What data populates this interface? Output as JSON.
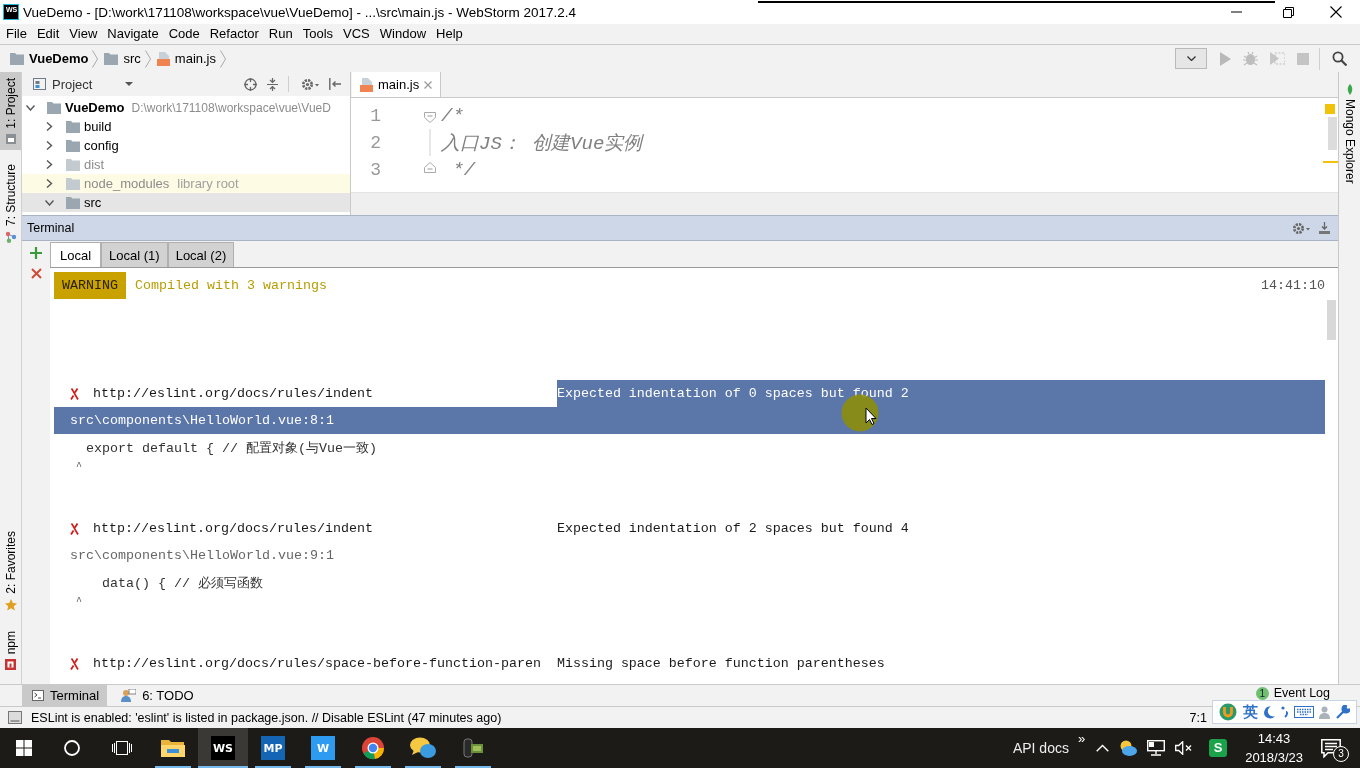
{
  "window": {
    "app_badge": "WS",
    "title": "VueDemo - [D:\\work\\171108\\workspace\\vue\\VueDemo] - ...\\src\\main.js - WebStorm 2017.2.4"
  },
  "menu_bar": [
    "File",
    "Edit",
    "View",
    "Navigate",
    "Code",
    "Refactor",
    "Run",
    "Tools",
    "VCS",
    "Window",
    "Help"
  ],
  "navigation_bar": {
    "breadcrumbs": [
      {
        "kind": "project",
        "label": "VueDemo"
      },
      {
        "kind": "folder",
        "label": "src"
      },
      {
        "kind": "js-file",
        "label": "main.js"
      }
    ]
  },
  "left_tool_strip": {
    "top": [
      {
        "kind": "project",
        "label": "1: Project",
        "selected": true
      },
      {
        "kind": "structure",
        "label": "7: Structure",
        "selected": false
      }
    ],
    "bottom": [
      {
        "kind": "favorites",
        "label": "2: Favorites",
        "selected": false
      },
      {
        "kind": "npm",
        "label": "npm",
        "selected": false
      }
    ]
  },
  "right_tool_strip": [
    {
      "kind": "mongo",
      "label": "Mongo Explorer",
      "selected": false
    }
  ],
  "project_panel": {
    "title": "Project",
    "tree": [
      {
        "name": "VueDemo",
        "path": "D:\\work\\171108\\workspace\\vue\\VueD",
        "expanded": true,
        "selected": false,
        "dimmed": false,
        "highlighted": false,
        "children": [
          {
            "name": "build",
            "expanded": false,
            "selected": false,
            "dimmed": false,
            "highlighted": false
          },
          {
            "name": "config",
            "expanded": false,
            "selected": false,
            "dimmed": false,
            "highlighted": false
          },
          {
            "name": "dist",
            "expanded": false,
            "selected": false,
            "dimmed": true,
            "highlighted": false
          },
          {
            "name": "node_modules",
            "note": "library root",
            "expanded": false,
            "selected": false,
            "dimmed": true,
            "highlighted": true
          },
          {
            "name": "src",
            "expanded": true,
            "selected": true,
            "dimmed": false,
            "highlighted": false
          }
        ]
      }
    ]
  },
  "editor": {
    "tabs": [
      {
        "label": "main.js",
        "selected": true
      }
    ],
    "lines": [
      {
        "kind": "fold-start",
        "number": "1",
        "text": "/*"
      },
      {
        "kind": "fold-inside",
        "number": "2",
        "text": "入口JS： 创建Vue实例"
      },
      {
        "kind": "fold-end",
        "number": "3",
        "text": " */"
      }
    ]
  },
  "terminal": {
    "title": "Terminal",
    "tabs": [
      {
        "label": "Local",
        "selected": true
      },
      {
        "label": "Local (1)",
        "selected": false
      },
      {
        "label": "Local (2)",
        "selected": false
      }
    ],
    "warning": {
      "badge": "WARNING",
      "text": "Compiled with 3 warnings",
      "time": "14:41:10"
    },
    "problems": [
      {
        "url": "http://eslint.org/docs/rules/indent",
        "message": "Expected indentation of 0 spaces but found 2",
        "location": "src\\components\\HelloWorld.vue:8:1",
        "code": "  export default { // 配置对象(与Vue一致)",
        "caret": " ^",
        "highlighted": true
      },
      {
        "url": "http://eslint.org/docs/rules/indent",
        "message": "Expected indentation of 2 spaces but found 4",
        "location": "src\\components\\HelloWorld.vue:9:1",
        "code": "    data() { // 必须写函数",
        "caret": " ^",
        "highlighted": false
      },
      {
        "url": "http://eslint.org/docs/rules/space-before-function-paren",
        "message": "Missing space before function parentheses",
        "highlighted": false
      }
    ]
  },
  "bottom_tool_bar": {
    "buttons": [
      {
        "kind": "terminal",
        "label": "Terminal",
        "selected": true
      },
      {
        "kind": "todo",
        "label": "6: TODO",
        "selected": false
      }
    ],
    "event_log": {
      "count": "1",
      "label": "Event Log"
    }
  },
  "status_bar": {
    "message": "ESLint is enabled: 'eslint' is listed in package.json. // Disable ESLint (47 minutes ago)",
    "position": "7:1"
  },
  "input_method_bar": {
    "language": "英"
  },
  "taskbar": {
    "apps": [
      {
        "kind": "folder",
        "active": false,
        "running": true
      },
      {
        "kind": "tile",
        "label": "WS",
        "color": "#000000",
        "active": true,
        "running": true
      },
      {
        "kind": "tile",
        "label": "MP",
        "color": "#1565b5",
        "active": false,
        "running": true
      },
      {
        "kind": "tile",
        "label": "W",
        "color": "#2d9bf0",
        "active": false,
        "running": true
      },
      {
        "kind": "ring",
        "active": false,
        "running": true
      },
      {
        "kind": "bubbles",
        "active": false,
        "running": true
      },
      {
        "kind": "camera",
        "active": false,
        "running": true
      }
    ],
    "tray": {
      "label": "API docs",
      "overflow": "»",
      "app_letter": "S",
      "time": "14:43",
      "date": "2018/3/23",
      "notifications": "3"
    }
  }
}
